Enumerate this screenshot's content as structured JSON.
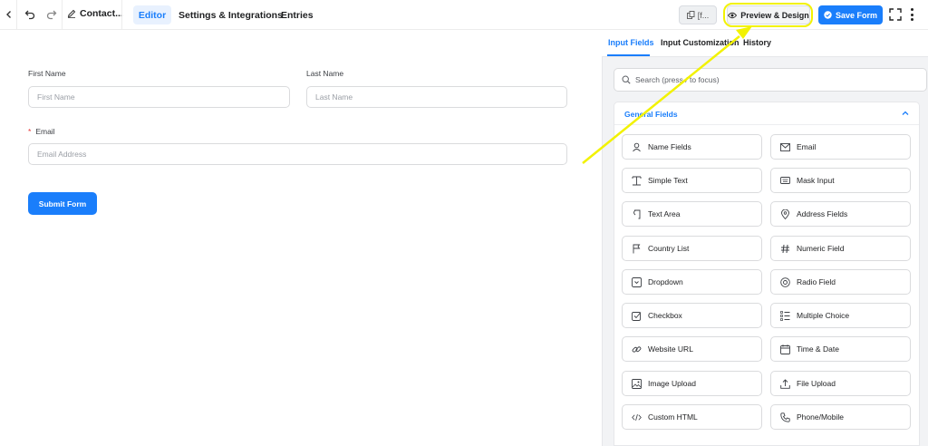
{
  "topbar": {
    "form_title": "Contact...",
    "nav": {
      "editor": "Editor",
      "settings": "Settings & Integrations",
      "entries": "Entries"
    },
    "shortcode_label": "[f...",
    "preview_label": "Preview & Design",
    "save_label": "Save Form"
  },
  "form": {
    "first_name_label": "First Name",
    "first_name_placeholder": "First Name",
    "last_name_label": "Last Name",
    "last_name_placeholder": "Last Name",
    "email_required_mark": "*",
    "email_label": "Email",
    "email_placeholder": "Email Address",
    "submit_label": "Submit Form"
  },
  "panel": {
    "tabs": [
      "Input Fields",
      "Input Customization",
      "History"
    ],
    "search_placeholder": "Search (press / to focus)",
    "section_title": "General Fields",
    "fields": [
      {
        "label": "Name Fields",
        "icon": "user-icon"
      },
      {
        "label": "Email",
        "icon": "envelope-icon"
      },
      {
        "label": "Simple Text",
        "icon": "text-cursor-icon"
      },
      {
        "label": "Mask Input",
        "icon": "keyboard-icon"
      },
      {
        "label": "Text Area",
        "icon": "paragraph-icon"
      },
      {
        "label": "Address Fields",
        "icon": "map-pin-icon"
      },
      {
        "label": "Country List",
        "icon": "flag-icon"
      },
      {
        "label": "Numeric Field",
        "icon": "hash-icon"
      },
      {
        "label": "Dropdown",
        "icon": "dropdown-icon"
      },
      {
        "label": "Radio Field",
        "icon": "radio-icon"
      },
      {
        "label": "Checkbox",
        "icon": "checkbox-icon"
      },
      {
        "label": "Multiple Choice",
        "icon": "list-icon"
      },
      {
        "label": "Website URL",
        "icon": "link-icon"
      },
      {
        "label": "Time & Date",
        "icon": "calendar-icon"
      },
      {
        "label": "Image Upload",
        "icon": "image-icon"
      },
      {
        "label": "File Upload",
        "icon": "upload-icon"
      },
      {
        "label": "Custom HTML",
        "icon": "code-icon"
      },
      {
        "label": "Phone/Mobile",
        "icon": "phone-icon"
      }
    ]
  },
  "colors": {
    "accent": "#1a7efb",
    "highlight": "#f2f200"
  }
}
